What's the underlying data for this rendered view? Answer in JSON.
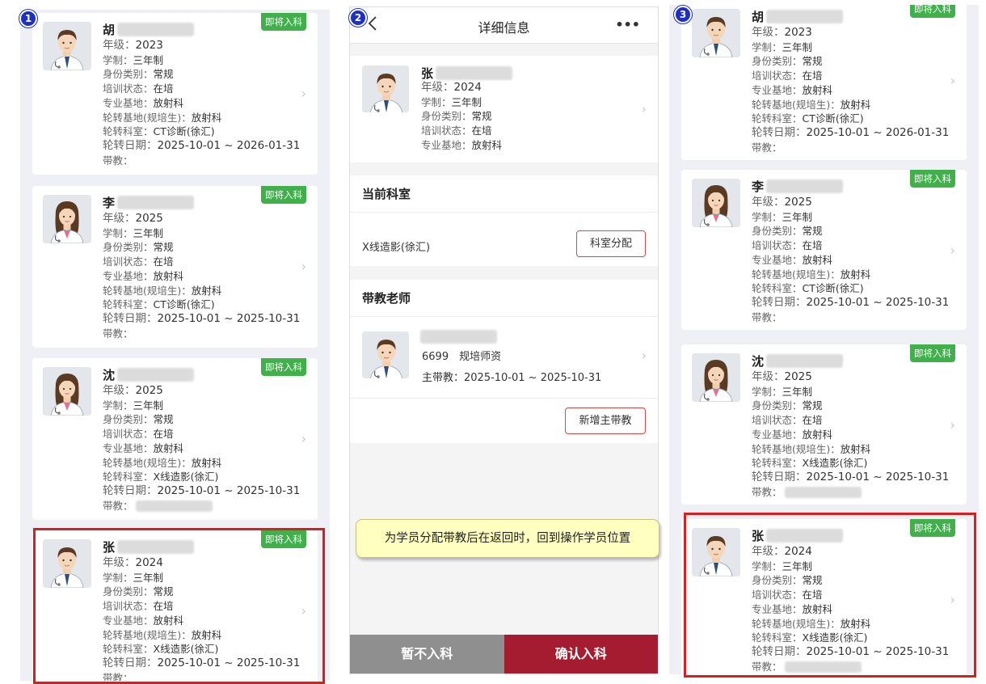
{
  "panel1": {
    "badge": "1",
    "cards": [
      {
        "name": "胡",
        "tag": "即将入科",
        "rows": [
          {
            "k": "年级：",
            "v": "2023",
            "big": true
          },
          {
            "k": "学制：",
            "v": "三年制"
          },
          {
            "k": "身份类别：",
            "v": "常规"
          },
          {
            "k": "培训状态：",
            "v": "在培"
          },
          {
            "k": "专业基地：",
            "v": "放射科"
          },
          {
            "k": "轮转基地(规培生)：",
            "v": "放射科"
          },
          {
            "k": "轮转科室：",
            "v": "CT诊断(徐汇)"
          },
          {
            "k": "轮转日期：",
            "v": "2025-10-01 ~ 2026-01-31",
            "big": true
          },
          {
            "k": "带教：",
            "v": ""
          }
        ]
      },
      {
        "name": "李",
        "tag": "即将入科",
        "rows": [
          {
            "k": "年级：",
            "v": "2025",
            "big": true
          },
          {
            "k": "学制：",
            "v": "三年制"
          },
          {
            "k": "身份类别：",
            "v": "常规"
          },
          {
            "k": "培训状态：",
            "v": "在培"
          },
          {
            "k": "专业基地：",
            "v": "放射科"
          },
          {
            "k": "轮转基地(规培生)：",
            "v": "放射科"
          },
          {
            "k": "轮转科室：",
            "v": "CT诊断(徐汇)"
          },
          {
            "k": "轮转日期：",
            "v": "2025-10-01 ~ 2025-10-31",
            "big": true
          },
          {
            "k": "带教：",
            "v": ""
          }
        ]
      },
      {
        "name": "沈",
        "tag": "即将入科",
        "rows": [
          {
            "k": "年级：",
            "v": "2025",
            "big": true
          },
          {
            "k": "学制：",
            "v": "三年制"
          },
          {
            "k": "身份类别：",
            "v": "常规"
          },
          {
            "k": "培训状态：",
            "v": "在培"
          },
          {
            "k": "专业基地：",
            "v": "放射科"
          },
          {
            "k": "轮转基地(规培生)：",
            "v": "放射科"
          },
          {
            "k": "轮转科室：",
            "v": "X线造影(徐汇)"
          },
          {
            "k": "轮转日期：",
            "v": "2025-10-01 ~ 2025-10-31",
            "big": true
          },
          {
            "k": "带教：",
            "v": "",
            "blurred": true
          }
        ]
      },
      {
        "name": "张",
        "tag": "即将入科",
        "rows": [
          {
            "k": "年级：",
            "v": "2024",
            "big": true
          },
          {
            "k": "学制：",
            "v": "三年制"
          },
          {
            "k": "身份类别：",
            "v": "常规"
          },
          {
            "k": "培训状态：",
            "v": "在培"
          },
          {
            "k": "专业基地：",
            "v": "放射科"
          },
          {
            "k": "轮转基地(规培生)：",
            "v": "放射科"
          },
          {
            "k": "轮转科室：",
            "v": "X线造影(徐汇)"
          },
          {
            "k": "轮转日期：",
            "v": "2025-10-01 ~ 2025-10-31",
            "big": true
          },
          {
            "k": "带教：",
            "v": ""
          }
        ]
      }
    ]
  },
  "panel2": {
    "badge": "2",
    "header": {
      "back_icon": "chevron-left-icon",
      "title": "详细信息",
      "more": "•••"
    },
    "student": {
      "name": "张",
      "rows": [
        {
          "k": "年级：",
          "v": "2024",
          "big": true
        },
        {
          "k": "学制：",
          "v": "三年制"
        },
        {
          "k": "身份类别：",
          "v": "常规"
        },
        {
          "k": "培训状态：",
          "v": "在培"
        },
        {
          "k": "专业基地：",
          "v": "放射科"
        }
      ]
    },
    "current_dept": {
      "title": "当前科室",
      "value": "X线造影(徐汇)",
      "button": "科室分配"
    },
    "teacher": {
      "title": "带教老师",
      "id_line": "6699　规培师资",
      "period": "主带教：2025-10-01 ~ 2025-10-31",
      "button": "新增主带教"
    },
    "note": "为学员分配带教后在返回时，回到操作学员位置",
    "footer": {
      "reject": "暂不入科",
      "confirm": "确认入科"
    },
    "colors": {
      "reject": "#8f8f8f",
      "confirm": "#a51c30"
    }
  },
  "panel3": {
    "badge": "3",
    "cards": [
      {
        "name": "胡",
        "tag": "即将入科",
        "rows": [
          {
            "k": "年级：",
            "v": "2023",
            "big": true
          },
          {
            "k": "学制：",
            "v": "三年制"
          },
          {
            "k": "身份类别：",
            "v": "常规"
          },
          {
            "k": "培训状态：",
            "v": "在培"
          },
          {
            "k": "专业基地：",
            "v": "放射科"
          },
          {
            "k": "轮转基地(规培生)：",
            "v": "放射科"
          },
          {
            "k": "轮转科室：",
            "v": "CT诊断(徐汇)"
          },
          {
            "k": "轮转日期：",
            "v": "2025-10-01 ~ 2026-01-31",
            "big": true
          },
          {
            "k": "带教：",
            "v": ""
          }
        ]
      },
      {
        "name": "李",
        "tag": "即将入科",
        "rows": [
          {
            "k": "年级：",
            "v": "2025",
            "big": true
          },
          {
            "k": "学制：",
            "v": "三年制"
          },
          {
            "k": "身份类别：",
            "v": "常规"
          },
          {
            "k": "培训状态：",
            "v": "在培"
          },
          {
            "k": "专业基地：",
            "v": "放射科"
          },
          {
            "k": "轮转基地(规培生)：",
            "v": "放射科"
          },
          {
            "k": "轮转科室：",
            "v": "CT诊断(徐汇)"
          },
          {
            "k": "轮转日期：",
            "v": "2025-10-01 ~ 2025-10-31",
            "big": true
          },
          {
            "k": "带教：",
            "v": ""
          }
        ]
      },
      {
        "name": "沈",
        "tag": "即将入科",
        "rows": [
          {
            "k": "年级：",
            "v": "2025",
            "big": true
          },
          {
            "k": "学制：",
            "v": "三年制"
          },
          {
            "k": "身份类别：",
            "v": "常规"
          },
          {
            "k": "培训状态：",
            "v": "在培"
          },
          {
            "k": "专业基地：",
            "v": "放射科"
          },
          {
            "k": "轮转基地(规培生)：",
            "v": "放射科"
          },
          {
            "k": "轮转科室：",
            "v": "X线造影(徐汇)"
          },
          {
            "k": "轮转日期：",
            "v": "2025-10-01 ~ 2025-10-31",
            "big": true
          },
          {
            "k": "带教：",
            "v": "",
            "blurred": true
          }
        ]
      },
      {
        "name": "张",
        "tag": "即将入科",
        "rows": [
          {
            "k": "年级：",
            "v": "2024",
            "big": true
          },
          {
            "k": "学制：",
            "v": "三年制"
          },
          {
            "k": "身份类别：",
            "v": "常规"
          },
          {
            "k": "培训状态：",
            "v": "在培"
          },
          {
            "k": "专业基地：",
            "v": "放射科"
          },
          {
            "k": "轮转基地(规培生)：",
            "v": "放射科"
          },
          {
            "k": "轮转科室：",
            "v": "X线造影(徐汇)"
          },
          {
            "k": "轮转日期：",
            "v": "2025-10-01 ~ 2025-10-31",
            "big": true
          },
          {
            "k": "带教：",
            "v": "",
            "blurred": true
          }
        ]
      }
    ]
  },
  "avatars": {
    "0": "male",
    "1": "female",
    "2": "female",
    "3": "male"
  },
  "accent": {
    "tag": "#3fb04a",
    "highlight": "#d81e1e"
  }
}
